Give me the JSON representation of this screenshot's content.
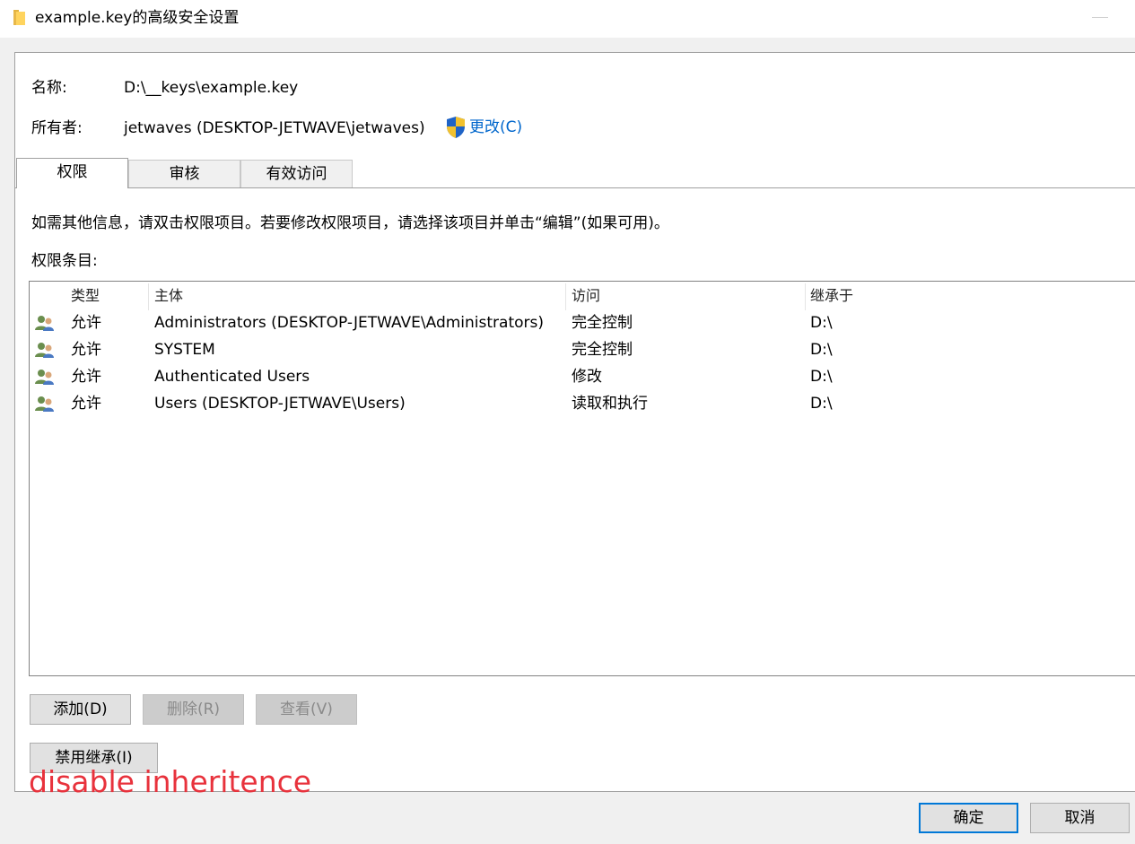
{
  "window": {
    "title": "example.key的高级安全设置",
    "icon": "folder-icon"
  },
  "info": {
    "name_label": "名称:",
    "name_value": "D:\\__keys\\example.key",
    "owner_label": "所有者:",
    "owner_value": "jetwaves (DESKTOP-JETWAVE\\jetwaves)",
    "change_link": "更改(C)",
    "change_icon": "uac-shield-icon"
  },
  "tabs": [
    {
      "label": "权限",
      "active": true
    },
    {
      "label": "审核",
      "active": false
    },
    {
      "label": "有效访问",
      "active": false
    }
  ],
  "instructions": "如需其他信息，请双击权限项目。若要修改权限项目，请选择该项目并单击“编辑”(如果可用)。",
  "entries_label": "权限条目:",
  "table": {
    "columns": [
      "类型",
      "主体",
      "访问",
      "继承于"
    ],
    "rows": [
      {
        "icon": "users-icon",
        "type": "允许",
        "principal": "Administrators (DESKTOP-JETWAVE\\Administrators)",
        "access": "完全控制",
        "inherited_from": "D:\\"
      },
      {
        "icon": "users-icon",
        "type": "允许",
        "principal": "SYSTEM",
        "access": "完全控制",
        "inherited_from": "D:\\"
      },
      {
        "icon": "users-icon",
        "type": "允许",
        "principal": "Authenticated Users",
        "access": "修改",
        "inherited_from": "D:\\"
      },
      {
        "icon": "users-icon",
        "type": "允许",
        "principal": "Users (DESKTOP-JETWAVE\\Users)",
        "access": "读取和执行",
        "inherited_from": "D:\\"
      }
    ]
  },
  "buttons": {
    "add": "添加(D)",
    "remove": "删除(R)",
    "view": "查看(V)",
    "disable_inheritance": "禁用继承(I)",
    "ok": "确定",
    "cancel": "取消"
  },
  "annotation": {
    "text": "disable inheritence",
    "color": "#e8323c"
  },
  "colors": {
    "link": "#0066cc",
    "default_button_border": "#0078d7"
  }
}
